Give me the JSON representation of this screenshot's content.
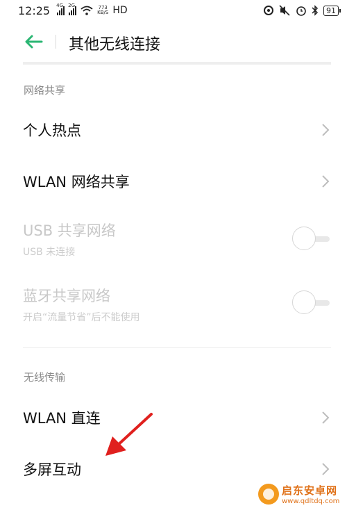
{
  "status_bar": {
    "time": "12:25",
    "sim1": "4G",
    "sim2": "2G",
    "speed_value": "773",
    "speed_unit": "KB/S",
    "hd": "HD",
    "battery": "91"
  },
  "header": {
    "title": "其他无线连接"
  },
  "sections": [
    {
      "label": "网络共享",
      "items": [
        {
          "title": "个人热点",
          "type": "chevron"
        },
        {
          "title": "WLAN 网络共享",
          "type": "chevron"
        },
        {
          "title": "USB 共享网络",
          "subtitle": "USB 未连接",
          "type": "toggle",
          "enabled": false
        },
        {
          "title": "蓝牙共享网络",
          "subtitle": "开启“流量节省”后不能使用",
          "type": "toggle",
          "enabled": false
        }
      ]
    },
    {
      "label": "无线传输",
      "items": [
        {
          "title": "WLAN 直连",
          "type": "chevron"
        },
        {
          "title": "多屏互动",
          "type": "chevron"
        }
      ]
    }
  ],
  "colors": {
    "accent": "#2bb673",
    "annotation_arrow": "#e0201e",
    "watermark": "#e0721a"
  },
  "watermark": {
    "name": "启东安卓网",
    "url": "www.qdltdq.com"
  }
}
